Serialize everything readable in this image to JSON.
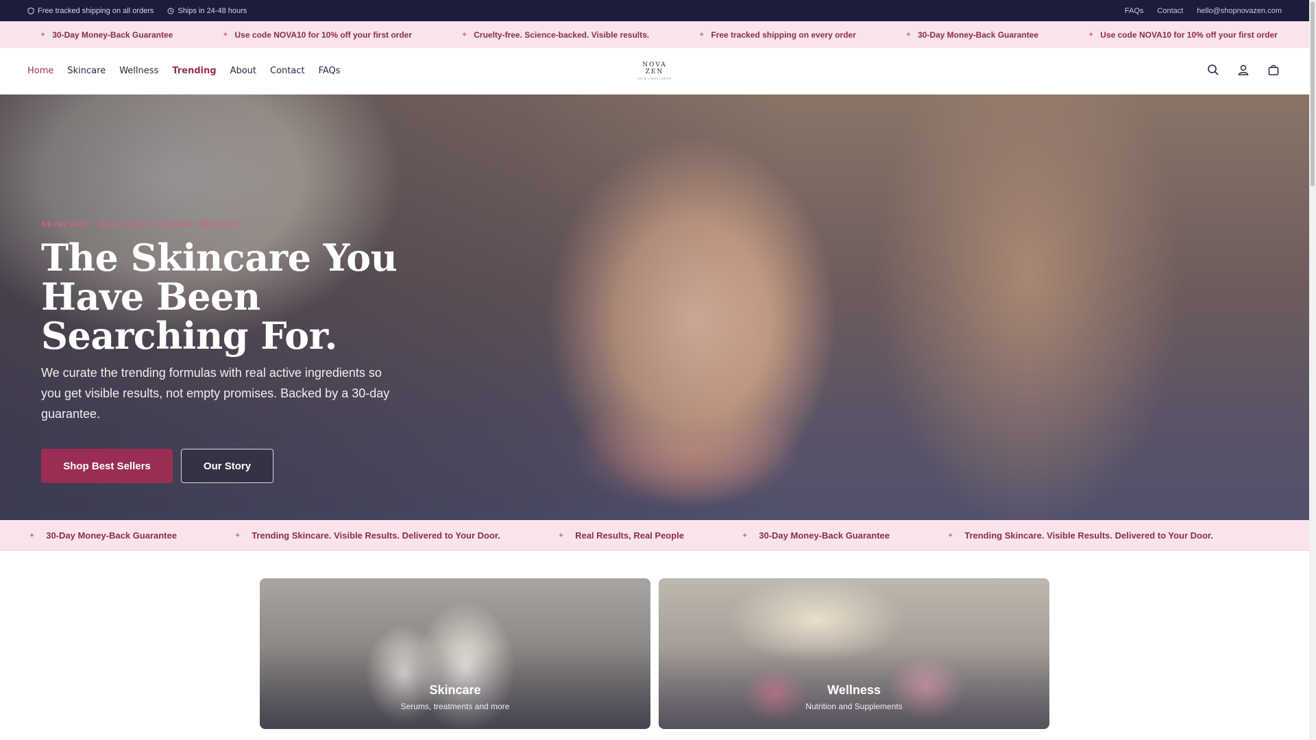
{
  "utility_bar": {
    "left": [
      {
        "icon": "shield-icon",
        "text": "Free tracked shipping on all orders"
      },
      {
        "icon": "clock-icon",
        "text": "Ships in 24-48 hours"
      }
    ],
    "links": {
      "faqs": "FAQs",
      "contact": "Contact",
      "email": "hello@shopnovazen.com"
    }
  },
  "top_marquee": [
    "30-Day Money-Back Guarantee",
    "Use code NOVA10 for 10% off your first order",
    "Cruelty-free. Science-backed. Visible results.",
    "Free tracked shipping on every order",
    "30-Day Money-Back Guarantee",
    "Use code NOVA10 for 10% off your first order"
  ],
  "nav": {
    "home": "Home",
    "skincare": "Skincare",
    "wellness": "Wellness",
    "trending": "Trending",
    "about": "About",
    "contact": "Contact",
    "faqs": "FAQs"
  },
  "logo": {
    "text": "NOVA ZEN",
    "tagline": "SKIN • WELLNESS"
  },
  "hero": {
    "eyebrow": "SKINCARE · WELLNESS · VISIBLE RESULTS",
    "title": "The Skincare You Have Been Searching For.",
    "description": "We curate the trending formulas with real active ingredients so you get visible results, not empty promises. Backed by a 30-day guarantee.",
    "primary_button": "Shop Best Sellers",
    "secondary_button": "Our Story"
  },
  "bottom_marquee": [
    "30-Day Money-Back Guarantee",
    "Trending Skincare. Visible Results. Delivered to Your Door.",
    "Real Results, Real People",
    "30-Day Money-Back Guarantee",
    "Trending Skincare. Visible Results. Delivered to Your Door."
  ],
  "categories": [
    {
      "title": "Skincare",
      "subtitle": "Serums, treatments and more"
    },
    {
      "title": "Wellness",
      "subtitle": "Nutrition and Supplements"
    }
  ],
  "colors": {
    "utility_bg": "#1b1d3a",
    "marquee_bg": "#f9e4ea",
    "accent": "#9b2d55"
  }
}
